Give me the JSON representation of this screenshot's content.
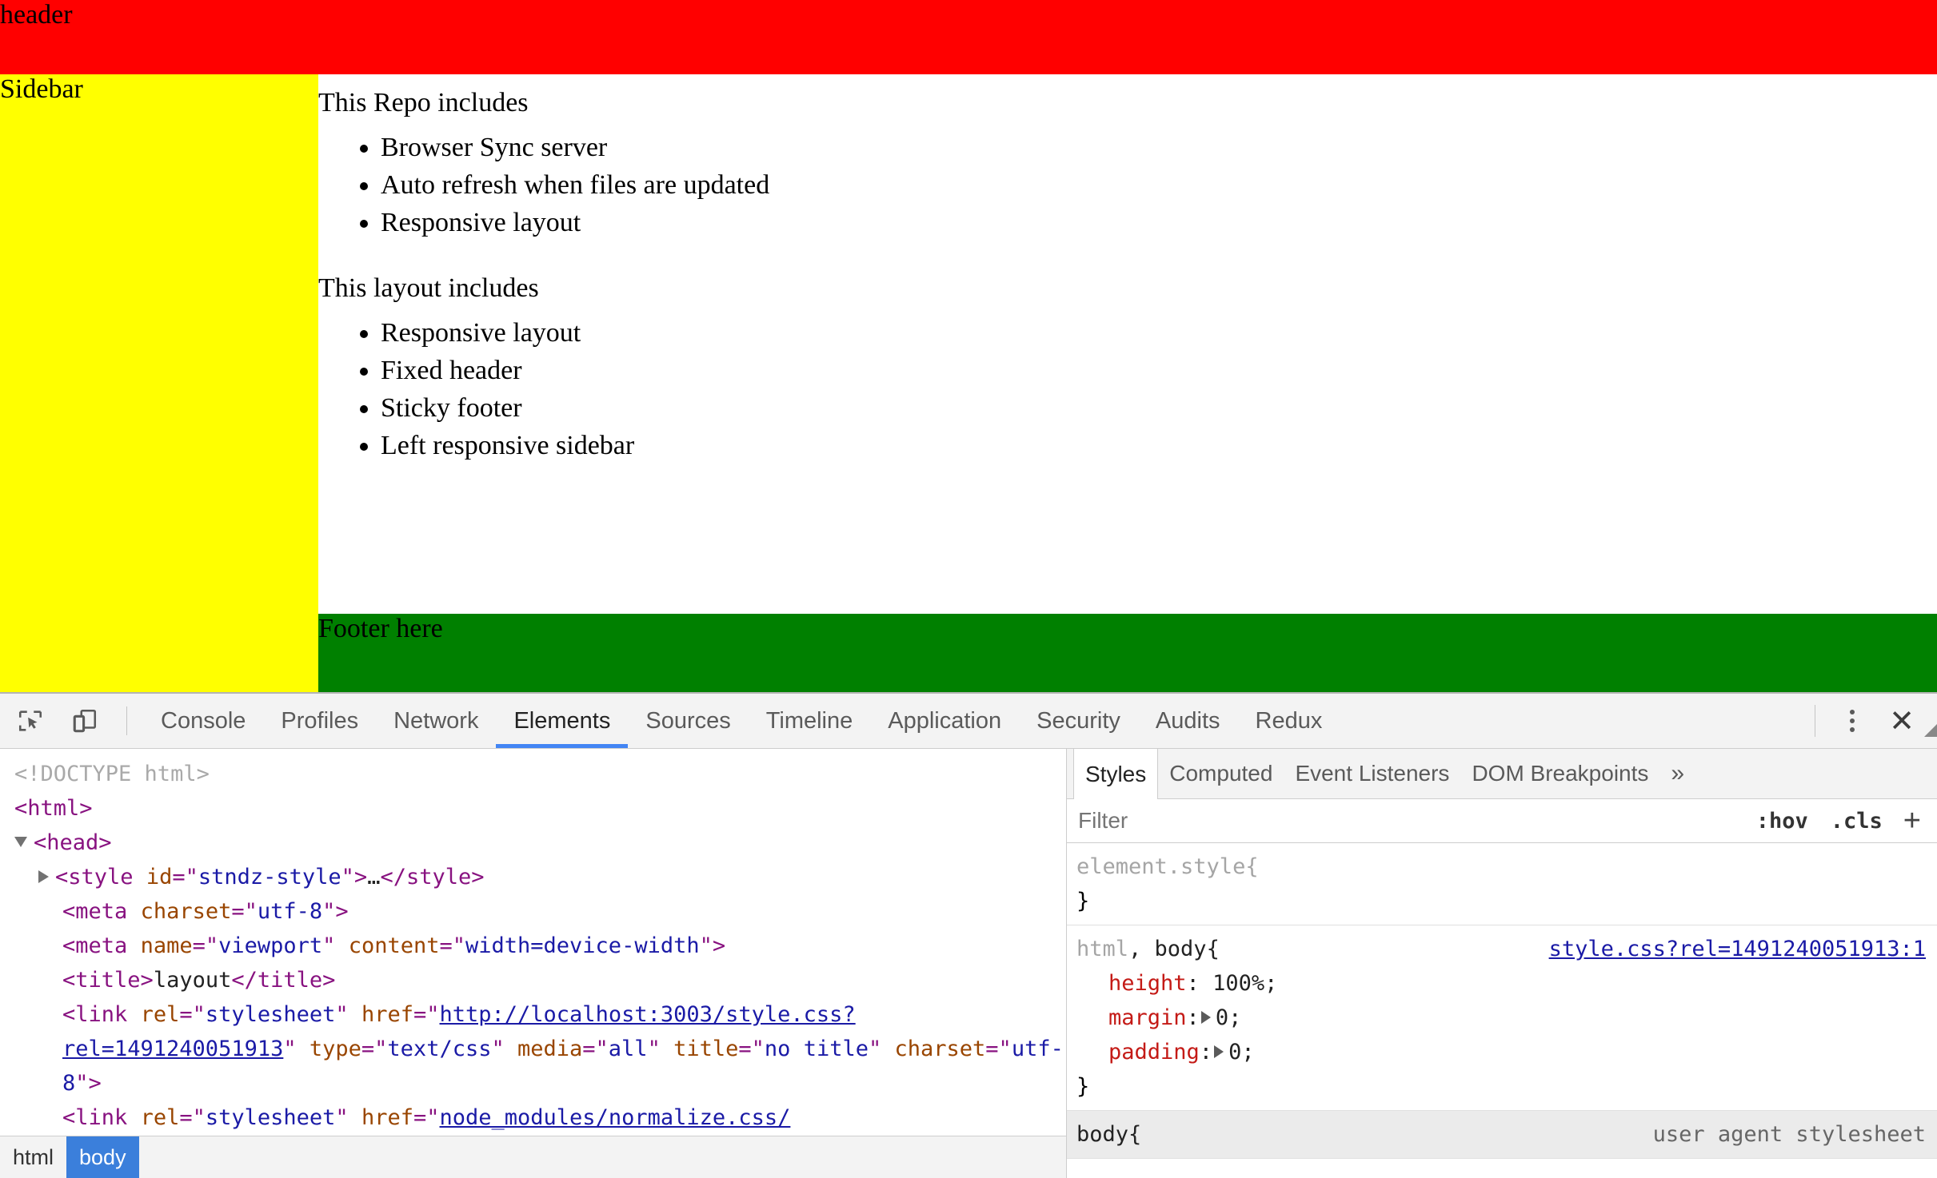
{
  "page": {
    "header_label": "header",
    "sidebar_label": "Sidebar",
    "footer_label": "Footer here",
    "main": {
      "heading_1": "This Repo includes",
      "list_1": [
        "Browser Sync server",
        "Auto refresh when files are updated",
        "Responsive layout"
      ],
      "heading_2": "This layout includes",
      "list_2": [
        "Responsive layout",
        "Fixed header",
        "Sticky footer",
        "Left responsive sidebar"
      ]
    },
    "colors": {
      "header_bg": "#ff0000",
      "sidebar_bg": "#ffff00",
      "footer_bg": "#008000",
      "main_bg": "#ffffff"
    }
  },
  "devtools": {
    "toolbar": {
      "inspect_icon": "inspect-element-icon",
      "device_icon": "device-toolbar-icon",
      "menu_icon": "kebab-menu-icon",
      "close_icon": "close-icon",
      "close_glyph": "✕"
    },
    "tabs": [
      {
        "label": "Console",
        "active": false
      },
      {
        "label": "Profiles",
        "active": false
      },
      {
        "label": "Network",
        "active": false
      },
      {
        "label": "Elements",
        "active": true
      },
      {
        "label": "Sources",
        "active": false
      },
      {
        "label": "Timeline",
        "active": false
      },
      {
        "label": "Application",
        "active": false
      },
      {
        "label": "Security",
        "active": false
      },
      {
        "label": "Audits",
        "active": false
      },
      {
        "label": "Redux",
        "active": false
      }
    ],
    "dom": {
      "l0_doctype": "<!DOCTYPE html>",
      "l1_html_open": "<html>",
      "l2_head_open": "<head>",
      "l3_style": "<style id=\"stndz-style\">…</style>",
      "l4_meta_charset": "<meta charset=\"utf-8\">",
      "l5_meta_viewport": "<meta name=\"viewport\" content=\"width=device-width\">",
      "l6_title": "<title>layout</title>",
      "l7_link_style": "<link rel=\"stylesheet\" href=\"http://localhost:3003/style.css?rel=1491240051913\" type=\"text/css\" media=\"all\" title=\"no title\" charset=\"utf-8\">",
      "l8_link_normalize": "<link rel=\"stylesheet\" href=\"node_modules/normalize.css/",
      "pieces": {
        "style_tag": "style",
        "style_attr": "id",
        "style_val": "stndz-style",
        "style_ellipsis": "…",
        "meta_tag": "meta",
        "charset_attr": "charset",
        "charset_val": "utf-8",
        "name_attr": "name",
        "name_val": "viewport",
        "content_attr": "content",
        "content_val": "width=device-width",
        "title_tag": "title",
        "title_text": "layout",
        "link_tag": "link",
        "rel_attr": "rel",
        "rel_val": "stylesheet",
        "href_attr": "href",
        "href_val_a": "http://localhost:3003/style.css?",
        "href_val_b": "rel=1491240051913",
        "type_attr": "type",
        "type_val": "text/css",
        "media_attr": "media",
        "media_val": "all",
        "title_attr": "title",
        "title_val_a": "no",
        "title_val_b": "title",
        "href_val_normalize": "node_modules/normalize.css/",
        "html_tag": "html",
        "head_tag": "head"
      }
    },
    "breadcrumb": [
      {
        "label": "html",
        "selected": false
      },
      {
        "label": "body",
        "selected": true
      }
    ],
    "sidebar_tabs": [
      {
        "label": "Styles",
        "active": true
      },
      {
        "label": "Computed",
        "active": false
      },
      {
        "label": "Event Listeners",
        "active": false
      },
      {
        "label": "DOM Breakpoints",
        "active": false
      }
    ],
    "sidebar_more_glyph": "»",
    "filter": {
      "placeholder": "Filter",
      "hov_label": ":hov",
      "cls_label": ".cls",
      "plus_label": "+"
    },
    "rules": [
      {
        "selector_grey": "",
        "selector_dark": "element.style",
        "brace_open": " {",
        "brace_close": "}",
        "origin": "",
        "declarations": []
      },
      {
        "selector_grey": "html",
        "selector_dark": ", body",
        "brace_open": " {",
        "brace_close": "}",
        "origin": "style.css?rel=1491240051913:1",
        "declarations": [
          {
            "prop": "height",
            "value": "100%;",
            "expandable": false
          },
          {
            "prop": "margin",
            "value": "0;",
            "expandable": true
          },
          {
            "prop": "padding",
            "value": "0;",
            "expandable": true
          }
        ]
      },
      {
        "selector_grey": "",
        "selector_dark": "body",
        "brace_open": " {",
        "brace_close": "}",
        "origin": "user agent stylesheet",
        "declarations": []
      }
    ]
  }
}
